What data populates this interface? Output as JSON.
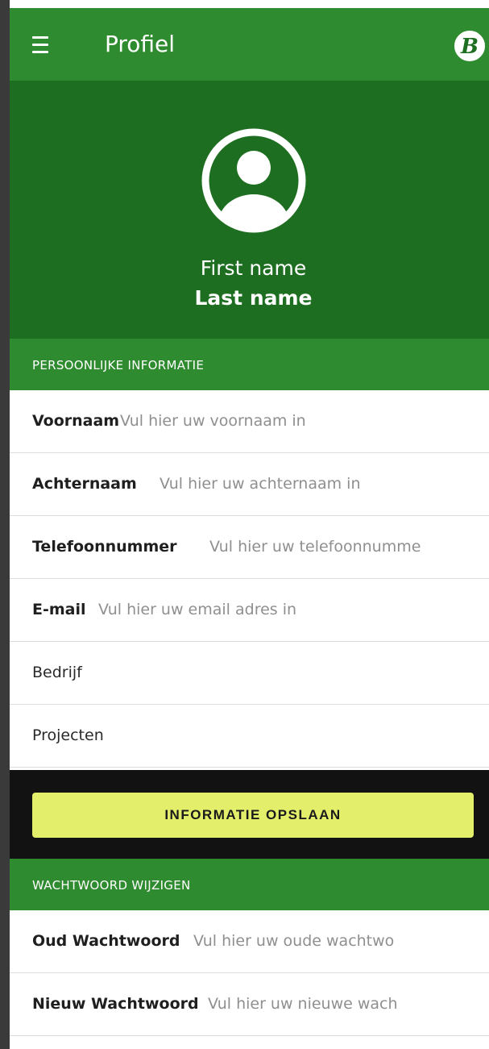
{
  "appbar": {
    "title": "Profiel",
    "logo_letter": "B"
  },
  "profile": {
    "first_name": "First name",
    "last_name": "Last name"
  },
  "personal_section": {
    "header": "PERSOONLIJKE INFORMATIE",
    "fields": [
      {
        "label": "Voornaam",
        "placeholder": "Vul hier uw voornaam in"
      },
      {
        "label": "Achternaam",
        "placeholder": "Vul hier uw achternaam in"
      },
      {
        "label": "Telefoonnummer",
        "placeholder": "Vul hier uw telefoonnumme"
      },
      {
        "label": "E-mail",
        "placeholder": "Vul hier uw email adres in"
      }
    ],
    "company_label": "Bedrijf",
    "projects_label": "Projecten",
    "save_label": "INFORMATIE OPSLAAN"
  },
  "password_section": {
    "header": "WACHTWOORD WIJZIGEN",
    "fields": [
      {
        "label": "Oud Wachtwoord",
        "placeholder": "Vul hier uw oude wachtwo"
      },
      {
        "label": "Nieuw Wachtwoord",
        "placeholder": "Vul hier uw nieuwe wach"
      }
    ]
  },
  "colors": {
    "appbar": "#2f8b2f",
    "hero": "#1e6e21",
    "save_button": "#e3ee6b",
    "save_bar": "#121212"
  }
}
